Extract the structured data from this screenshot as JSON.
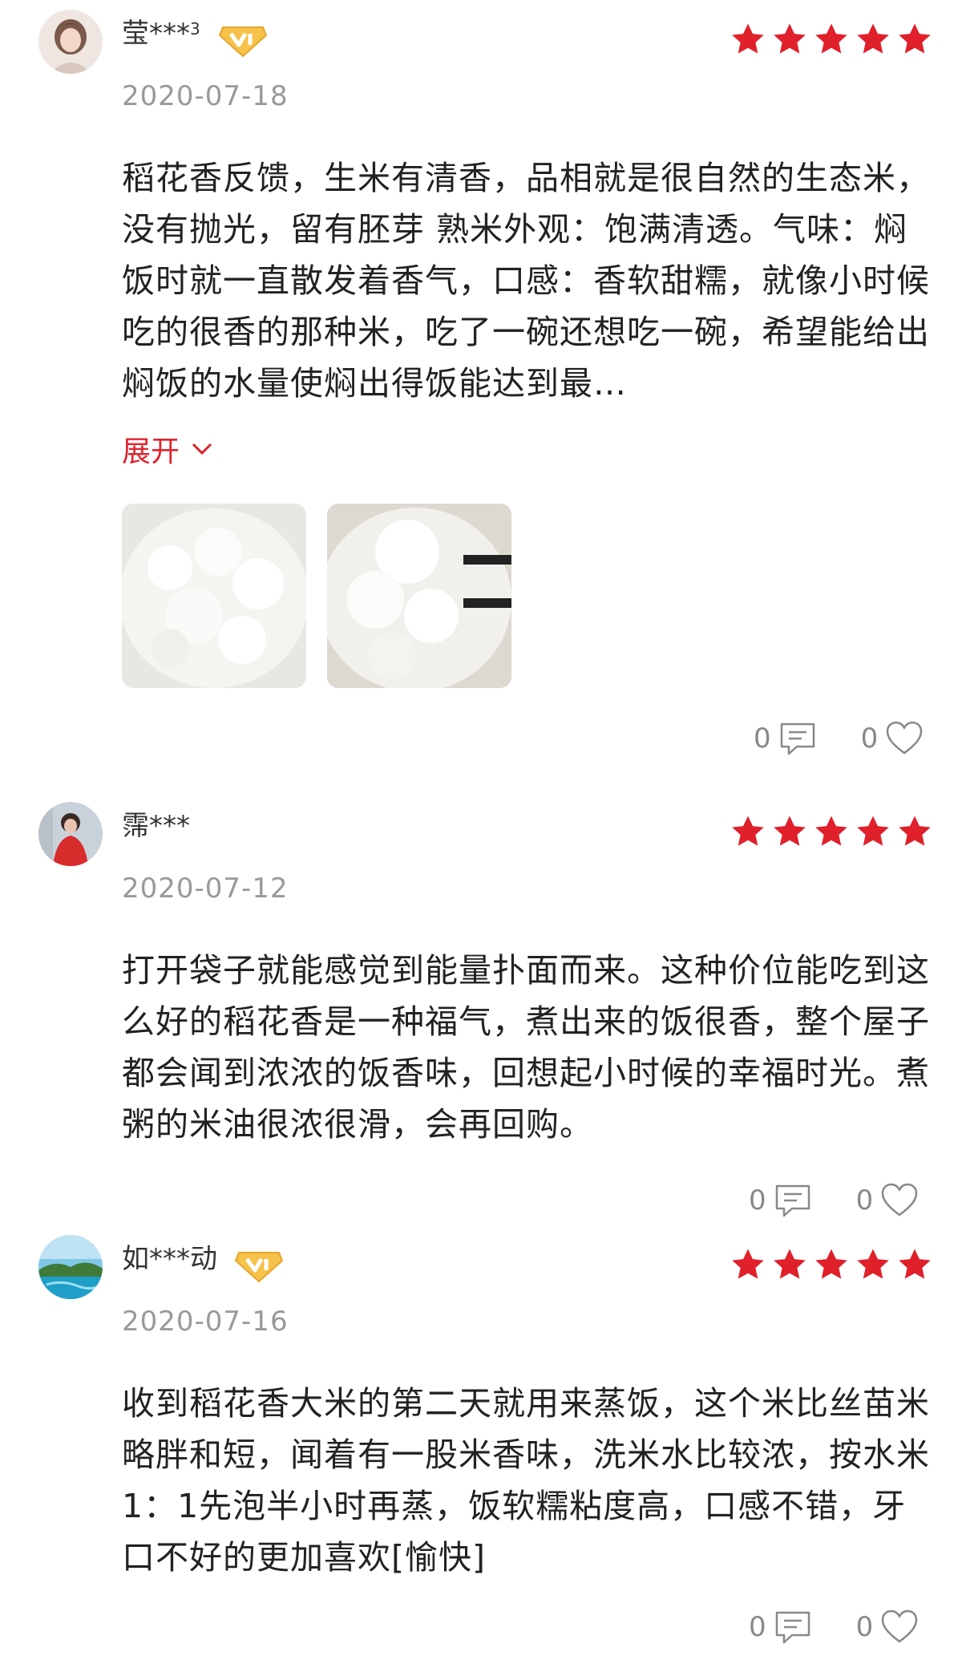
{
  "reviews": [
    {
      "username": "莹***",
      "username_sup": "3",
      "has_vip": true,
      "rating": 5,
      "date": "2020-07-18",
      "content": "稻花香反馈，生米有清香，品相就是很自然的生态米，没有抛光，留有胚芽 熟米外观：饱满清透。气味：焖饭时就一直散发着香气，口感：香软甜糯，就像小时候吃的很香的那种米，吃了一碗还想吃一碗，希望能给出焖饭的水量使焖出得饭能达到最…",
      "expand_label": "展开",
      "comments": "0",
      "likes": "0"
    },
    {
      "username": "霈***",
      "has_vip": false,
      "rating": 5,
      "date": "2020-07-12",
      "content": "打开袋子就能感觉到能量扑面而来。这种价位能吃到这么好的稻花香是一种福气，煮出来的饭很香，整个屋子都会闻到浓浓的饭香味，回想起小时候的幸福时光。煮粥的米油很浓很滑，会再回购。",
      "comments": "0",
      "likes": "0"
    },
    {
      "username": "如***动",
      "has_vip": true,
      "rating": 5,
      "date": "2020-07-16",
      "content": "收到稻花香大米的第二天就用来蒸饭，这个米比丝苗米略胖和短，闻着有一股米香味，洗米水比较浓，按水米1：1先泡半小时再蒸，饭软糯粘度高，口感不错，牙口不好的更加喜欢[愉快]",
      "comments": "0",
      "likes": "0"
    }
  ],
  "colors": {
    "star": "#e0202a",
    "accent": "#e0232d",
    "vip_gold": "#f2b33d",
    "muted": "#999999"
  },
  "icons": {
    "star": "star-icon",
    "vip": "vip-badge-icon",
    "comment": "comment-icon",
    "like": "heart-icon",
    "expand": "chevron-down-icon"
  }
}
